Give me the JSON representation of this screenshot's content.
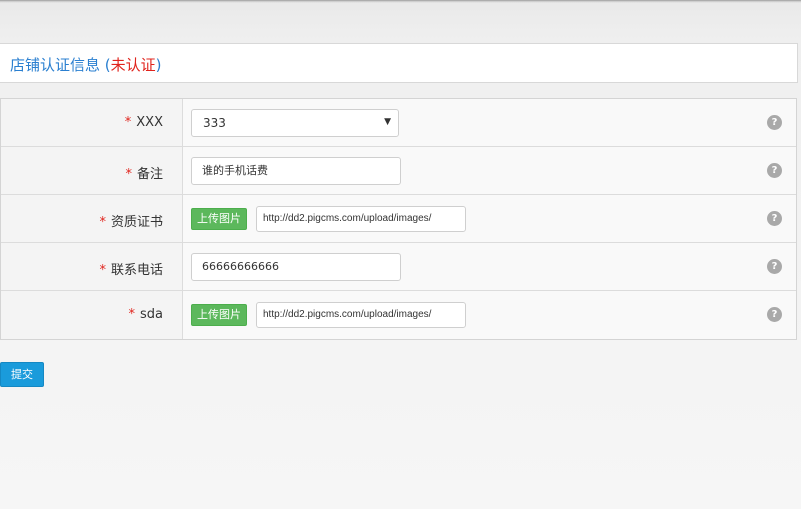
{
  "page_title": {
    "main": "店铺认证信息",
    "status": "未认证"
  },
  "form": {
    "required_mark": "*",
    "rows": [
      {
        "label": "XXX",
        "type": "select",
        "value": "333"
      },
      {
        "label": "备注",
        "type": "text",
        "value": "谁的手机话费"
      },
      {
        "label": "资质证书",
        "type": "upload",
        "button_label": "上传图片",
        "value": "http://dd2.pigcms.com/upload/images/"
      },
      {
        "label": "联系电话",
        "type": "text",
        "value": "66666666666"
      },
      {
        "label": "sda",
        "type": "upload",
        "button_label": "上传图片",
        "value": "http://dd2.pigcms.com/upload/images/"
      }
    ],
    "help_glyph": "?",
    "select_arrow": "▼"
  },
  "submit_label": "提交",
  "colors": {
    "title": "#2a7fd0",
    "status": "#e0231c",
    "required": "#e0231c",
    "upload_button": "#5cb85c",
    "submit_button": "#1a9bdb",
    "help_icon": "#a9a9a9"
  },
  "icons": {
    "help": "question-circle-icon",
    "dropdown": "caret-down-icon"
  }
}
